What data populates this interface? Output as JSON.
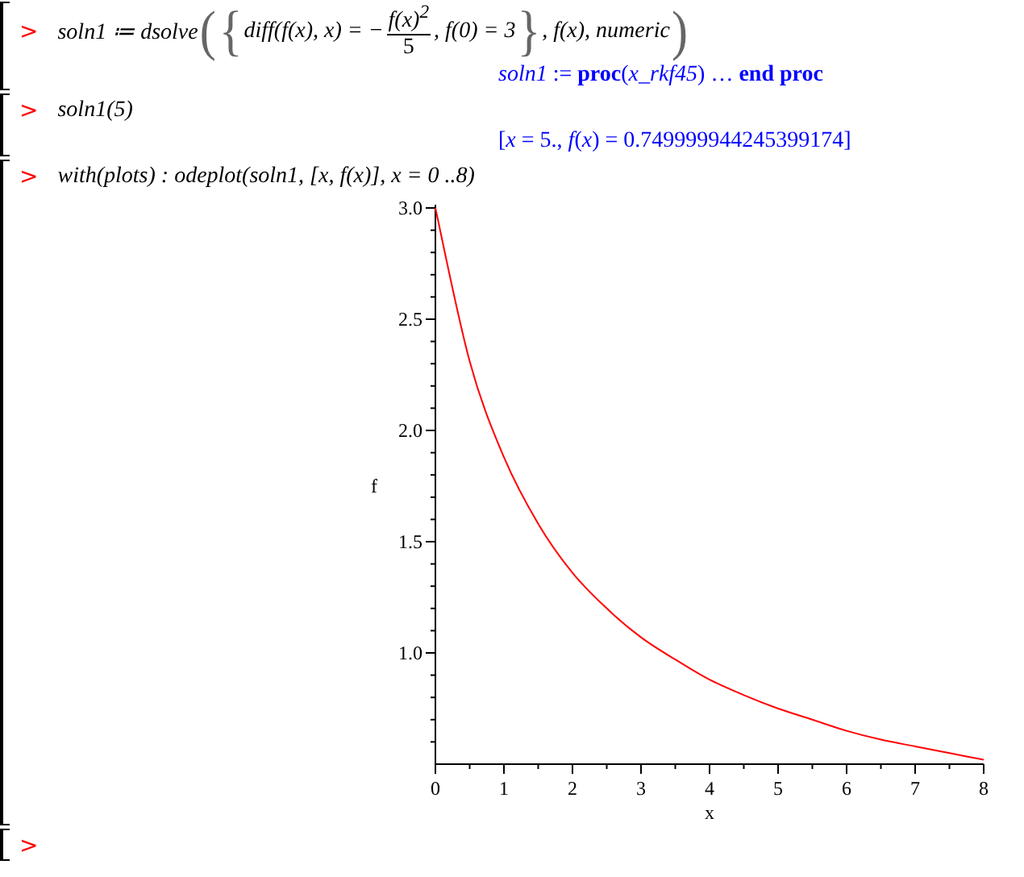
{
  "worksheet": {
    "groups": [
      {
        "prompt": ">",
        "command": [
          {
            "kind": "text",
            "text": "soln1 ≔ dsolve"
          },
          {
            "kind": "big",
            "text": "("
          },
          {
            "kind": "big",
            "text": "{"
          },
          {
            "kind": "text",
            "text": "diff(f(x), x) = −"
          },
          {
            "kind": "fraction",
            "numerator": "f(x)$^{2}$",
            "denominator": "5"
          },
          {
            "kind": "text",
            "text": ", f(0) = 3"
          },
          {
            "kind": "big",
            "text": "}"
          },
          {
            "kind": "text",
            "text": ", f(x), numeric"
          },
          {
            "kind": "big",
            "text": ")"
          }
        ],
        "output": "*soln1* := **proc**(*x_rkf45*) … **end proc**"
      },
      {
        "prompt": ">",
        "command": [
          {
            "kind": "text",
            "text": "soln1(5)"
          }
        ],
        "output": "[*x* = 5., *f*(*x*) = 0.749999944245399174]"
      },
      {
        "prompt": ">",
        "command": [
          {
            "kind": "text",
            "text": "with(plots) : odeplot(soln1, [x, f(x)], x = 0 ..8)"
          }
        ],
        "chart_data": {
          "type": "line",
          "xlabel": "x",
          "ylabel": "f",
          "x": [
            0,
            0.5,
            1,
            1.5,
            2,
            2.5,
            3,
            3.5,
            4,
            4.5,
            5,
            5.5,
            6,
            6.5,
            7,
            7.5,
            8
          ],
          "series": [
            {
              "color": "#ff0000",
              "values": [
                3,
                2.31,
                1.88,
                1.58,
                1.36,
                1.2,
                1.07,
                0.97,
                0.88,
                0.81,
                0.75,
                0.7,
                0.65,
                0.61,
                0.58,
                0.55,
                0.52
              ]
            }
          ],
          "xlim": [
            0,
            8
          ],
          "ylim": [
            0.5,
            3
          ],
          "xticks": [
            0,
            1,
            2,
            3,
            4,
            5,
            6,
            7,
            8
          ],
          "yticks": [
            {
              "value": 1,
              "label": "1.0"
            },
            {
              "value": 1.5,
              "label": "1.5"
            },
            {
              "value": 2,
              "label": "2.0"
            },
            {
              "value": 2.5,
              "label": "2.5"
            },
            {
              "value": 3,
              "label": "3.0"
            }
          ]
        }
      },
      {
        "prompt": ">"
      }
    ]
  }
}
